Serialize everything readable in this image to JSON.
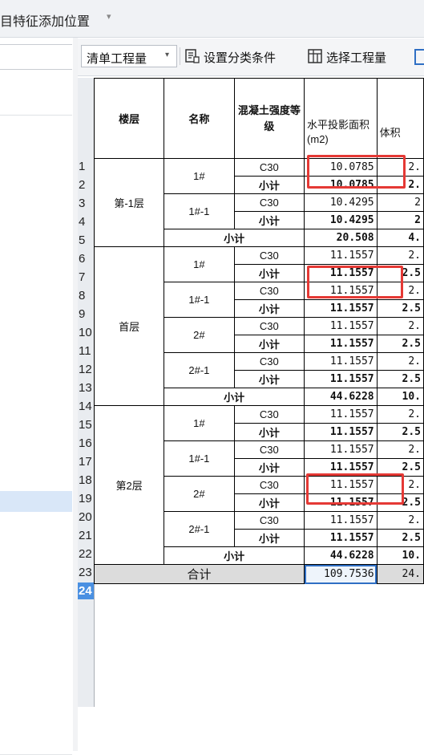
{
  "topbar": {
    "breadcrumb": "目特征添加位置",
    "caret": "▾"
  },
  "toolbar": {
    "dropdown_label": "清单工程量",
    "dropdown_caret": "▾",
    "btn_filter_label": "设置分类条件",
    "btn_select_label": "选择工程量"
  },
  "table": {
    "headers": {
      "floor": "楼层",
      "name": "名称",
      "grade": "混凝土强度等级",
      "area": "水平投影面积(m2)",
      "volume": "体积"
    },
    "row_numbers": [
      "1",
      "2",
      "3",
      "4",
      "5",
      "6",
      "7",
      "8",
      "9",
      "10",
      "11",
      "12",
      "13",
      "14",
      "15",
      "16",
      "17",
      "18",
      "19",
      "20",
      "21",
      "22",
      "23",
      "24"
    ],
    "floors": [
      "第-1层",
      "首层",
      "第2层"
    ],
    "names": [
      "1#",
      "1#-1",
      "1#",
      "1#-1",
      "2#",
      "2#-1",
      "1#",
      "1#-1",
      "2#",
      "2#-1"
    ],
    "grade": "C30",
    "subtotal_label": "小计",
    "total_label": "合计",
    "area_values": [
      "10.0785",
      "10.0785",
      "10.4295",
      "10.4295",
      "20.508",
      "11.1557",
      "11.1557",
      "11.1557",
      "11.1557",
      "11.1557",
      "11.1557",
      "11.1557",
      "11.1557",
      "44.6228",
      "11.1557",
      "11.1557",
      "11.1557",
      "11.1557",
      "11.1557",
      "11.1557",
      "11.1557",
      "11.1557",
      "44.6228",
      "109.7536"
    ],
    "volume_values": [
      "2.",
      "2.",
      "2",
      "2",
      "4.",
      "2.",
      "2.5",
      "2.",
      "2.5",
      "2.",
      "2.5",
      "2.",
      "2.5",
      "10.",
      "2.",
      "2.5",
      "2.",
      "2.5",
      "2.",
      "2.5",
      "2.",
      "2.5",
      "10.",
      "24."
    ]
  },
  "colors": {
    "highlight": "#e53935",
    "active_row": "#4a90e2",
    "selection": "#d9e7f8"
  }
}
